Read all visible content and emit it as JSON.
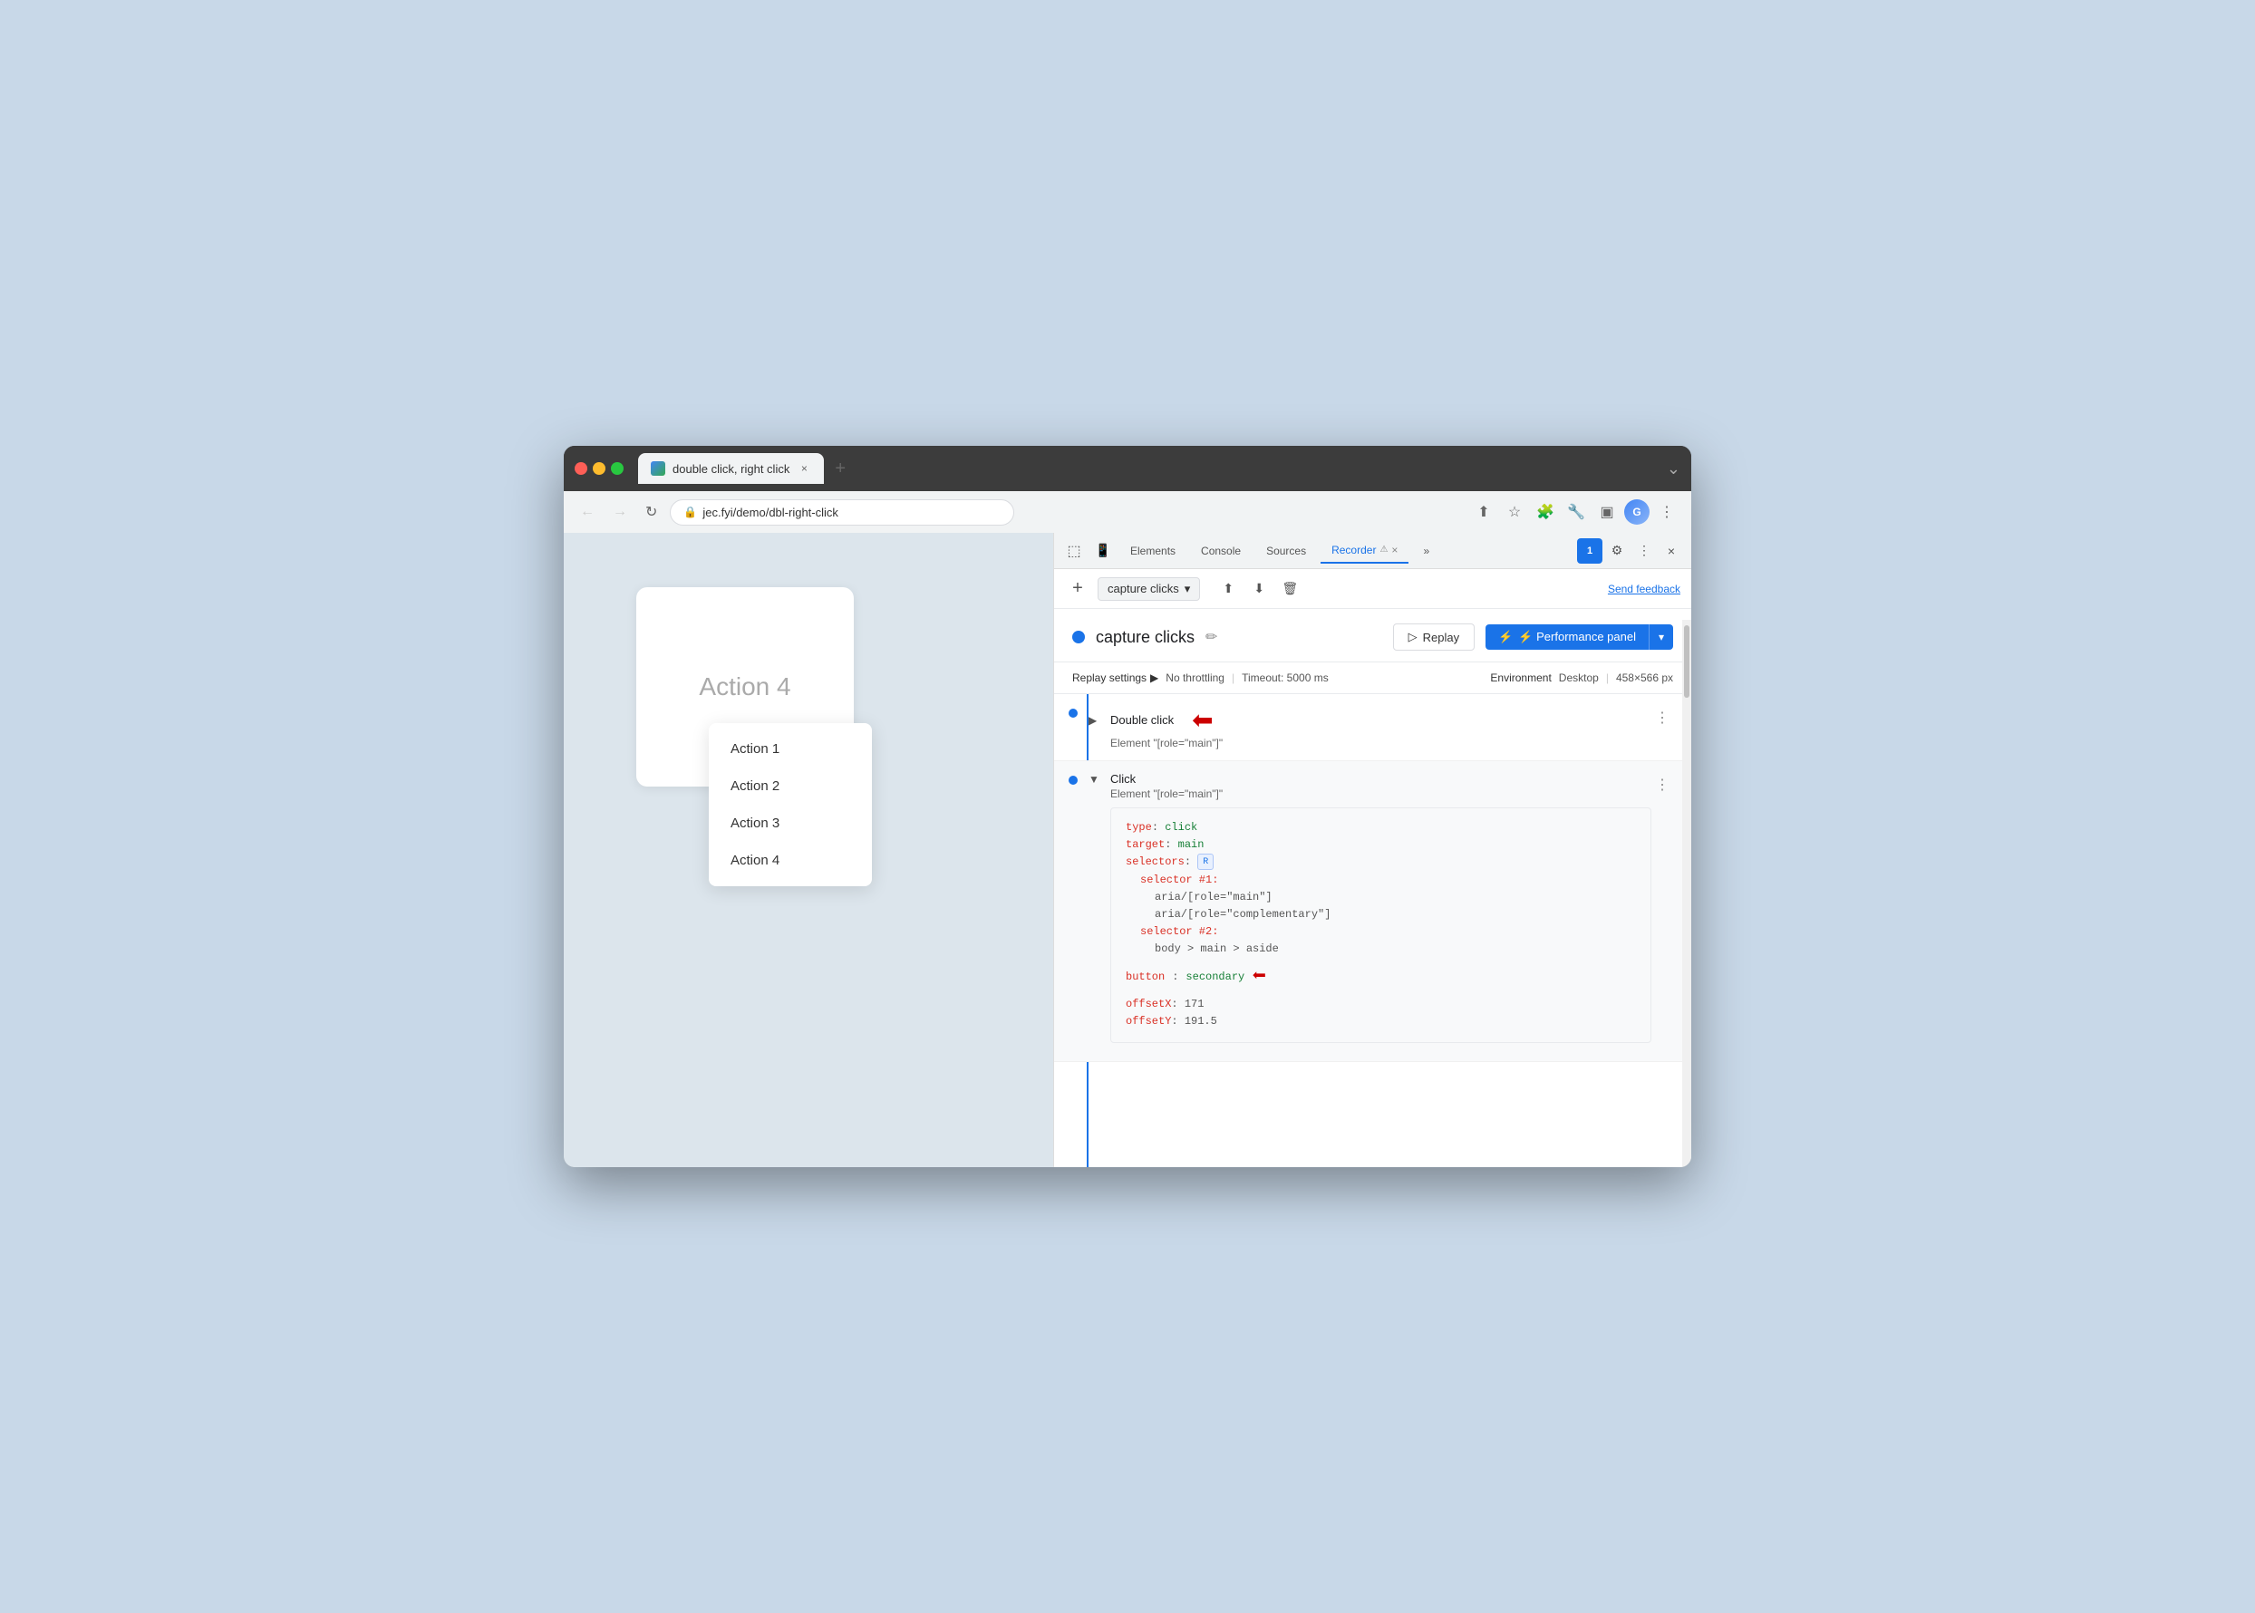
{
  "browser": {
    "tab_title": "double click, right click",
    "url": "jec.fyi/demo/dbl-right-click"
  },
  "devtools": {
    "tabs": [
      {
        "label": "Elements",
        "active": false
      },
      {
        "label": "Console",
        "active": false
      },
      {
        "label": "Sources",
        "active": false
      },
      {
        "label": "Recorder",
        "active": true
      },
      {
        "label": "»",
        "active": false
      }
    ],
    "badge_count": "1",
    "close_label": "×"
  },
  "recorder": {
    "add_label": "+",
    "name": "capture clicks",
    "name_dropdown_icon": "▾",
    "replay_label": "▷ Replay",
    "perf_panel_label": "⚡ Performance panel",
    "perf_panel_dropdown": "▾",
    "send_feedback": "Send feedback",
    "edit_icon": "✏",
    "settings_title": "Replay settings",
    "settings_arrow": "▶",
    "no_throttling": "No throttling",
    "timeout": "Timeout: 5000 ms",
    "env_label": "Environment",
    "env_type": "Desktop",
    "env_size": "458×566 px"
  },
  "steps": [
    {
      "id": "step1",
      "expand": "▶",
      "title": "Double click",
      "subtitle": "Element \"[role=\"main\"]\"",
      "expanded": false,
      "has_arrow": true
    },
    {
      "id": "step2",
      "expand": "▼",
      "title": "Click",
      "subtitle": "Element \"[role=\"main\"]\"",
      "expanded": true,
      "has_arrow": false,
      "code": {
        "type_key": "type",
        "type_val": "click",
        "target_key": "target",
        "target_val": "main",
        "selectors_key": "selectors",
        "selector1_label": "selector #1:",
        "selector1_v1": "aria/[role=\"main\"]",
        "selector1_v2": "aria/[role=\"complementary\"]",
        "selector2_label": "selector #2:",
        "selector2_v1": "body > main > aside",
        "button_key": "button",
        "button_val": "secondary",
        "offsetx_key": "offsetX",
        "offsetx_val": "171",
        "offsety_key": "offsetY",
        "offsety_val": "191.5"
      },
      "has_arrow2": true
    }
  ],
  "page": {
    "card_text": "Action 4",
    "menu_items": [
      "Action 1",
      "Action 2",
      "Action 3",
      "Action 4"
    ]
  }
}
